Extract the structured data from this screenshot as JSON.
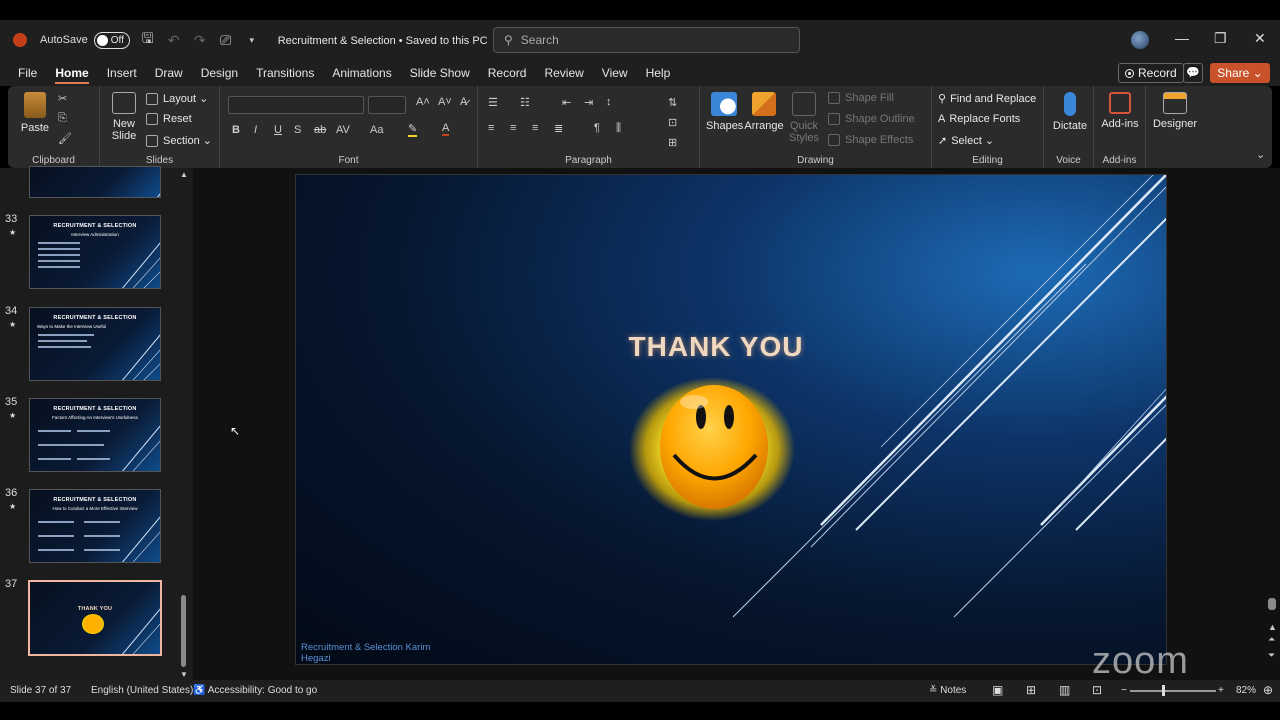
{
  "titlebar": {
    "autosave_label": "AutoSave",
    "autosave_state": "Off",
    "doc_title": "Recruitment & Selection • Saved to this PC",
    "search_placeholder": "Search"
  },
  "menu": {
    "tabs": [
      "File",
      "Home",
      "Insert",
      "Draw",
      "Design",
      "Transitions",
      "Animations",
      "Slide Show",
      "Record",
      "Review",
      "View",
      "Help"
    ],
    "active": "Home",
    "record_label": "Record",
    "share_label": "Share"
  },
  "ribbon": {
    "clipboard": {
      "label": "Clipboard",
      "paste": "Paste"
    },
    "slides": {
      "label": "Slides",
      "new_slide": "New Slide",
      "layout": "Layout",
      "reset": "Reset",
      "section": "Section"
    },
    "font": {
      "label": "Font",
      "buttons": [
        "B",
        "I",
        "U",
        "S",
        "ab",
        "AV",
        "Aa",
        "A"
      ]
    },
    "paragraph": {
      "label": "Paragraph"
    },
    "drawing": {
      "label": "Drawing",
      "shapes": "Shapes",
      "arrange": "Arrange",
      "quick_styles": "Quick Styles",
      "shape_fill": "Shape Fill",
      "shape_outline": "Shape Outline",
      "shape_effects": "Shape Effects"
    },
    "editing": {
      "label": "Editing",
      "find_replace": "Find and Replace",
      "replace_fonts": "Replace Fonts",
      "select": "Select"
    },
    "voice": {
      "label": "Voice",
      "dictate": "Dictate"
    },
    "addins": {
      "label": "Add-ins",
      "addins_btn": "Add-ins"
    },
    "designer": {
      "designer_btn": "Designer"
    }
  },
  "thumbnails": [
    {
      "num": "33",
      "title": "RECRUITMENT & SELECTION",
      "subtitle": "Interview Administration",
      "starred": true
    },
    {
      "num": "34",
      "title": "RECRUITMENT & SELECTION",
      "subtitle": "Ways to Make the Interview Useful",
      "starred": true
    },
    {
      "num": "35",
      "title": "RECRUITMENT & SELECTION",
      "subtitle": "Factors Affecting An Interview's Usefulness",
      "starred": true
    },
    {
      "num": "36",
      "title": "RECRUITMENT & SELECTION",
      "subtitle": "How to Conduct a More Effective Interview",
      "starred": true
    },
    {
      "num": "37",
      "title": "THANK YOU",
      "subtitle": "",
      "starred": false
    }
  ],
  "slide": {
    "title": "THANK YOU",
    "footer": "Recruitment & Selection Karim Hegazi"
  },
  "watermark": "zoom",
  "statusbar": {
    "slide_info": "Slide 37 of 37",
    "language": "English (United States)",
    "accessibility": "Accessibility: Good to go",
    "notes": "Notes",
    "zoom": "82%"
  }
}
